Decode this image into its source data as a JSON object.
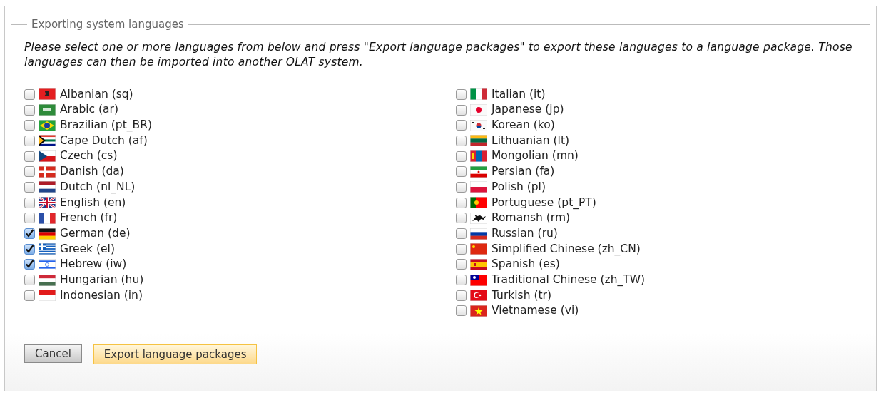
{
  "legend": "Exporting system languages",
  "description": "Please select one or more languages from below and press \"Export language packages\" to export these languages to a language package. Those languages can then be imported into another OLAT system.",
  "columns": [
    {
      "languages": [
        {
          "label": "Albanian (sq)",
          "checked": false
        },
        {
          "label": "Arabic (ar)",
          "checked": false
        },
        {
          "label": "Brazilian (pt_BR)",
          "checked": false
        },
        {
          "label": "Cape Dutch (af)",
          "checked": false
        },
        {
          "label": "Czech (cs)",
          "checked": false
        },
        {
          "label": "Danish (da)",
          "checked": false
        },
        {
          "label": "Dutch (nl_NL)",
          "checked": false
        },
        {
          "label": "English (en)",
          "checked": false
        },
        {
          "label": "French (fr)",
          "checked": false
        },
        {
          "label": "German (de)",
          "checked": true
        },
        {
          "label": "Greek (el)",
          "checked": true
        },
        {
          "label": "Hebrew (iw)",
          "checked": true
        },
        {
          "label": "Hungarian (hu)",
          "checked": false
        },
        {
          "label": "Indonesian (in)",
          "checked": false
        }
      ]
    },
    {
      "languages": [
        {
          "label": "Italian (it)",
          "checked": false
        },
        {
          "label": "Japanese (jp)",
          "checked": false
        },
        {
          "label": "Korean (ko)",
          "checked": false
        },
        {
          "label": "Lithuanian (lt)",
          "checked": false
        },
        {
          "label": "Mongolian (mn)",
          "checked": false
        },
        {
          "label": "Persian (fa)",
          "checked": false
        },
        {
          "label": "Polish (pl)",
          "checked": false
        },
        {
          "label": "Portuguese (pt_PT)",
          "checked": false
        },
        {
          "label": "Romansh (rm)",
          "checked": false
        },
        {
          "label": "Russian (ru)",
          "checked": false
        },
        {
          "label": "Simplified Chinese (zh_CN)",
          "checked": false
        },
        {
          "label": "Spanish (es)",
          "checked": false
        },
        {
          "label": "Traditional Chinese (zh_TW)",
          "checked": false
        },
        {
          "label": "Turkish (tr)",
          "checked": false
        },
        {
          "label": "Vietnamese (vi)",
          "checked": false
        }
      ]
    }
  ],
  "buttons": [
    {
      "label": "Cancel",
      "kind": "secondary"
    },
    {
      "label": "Export language packages",
      "kind": "primary"
    }
  ]
}
